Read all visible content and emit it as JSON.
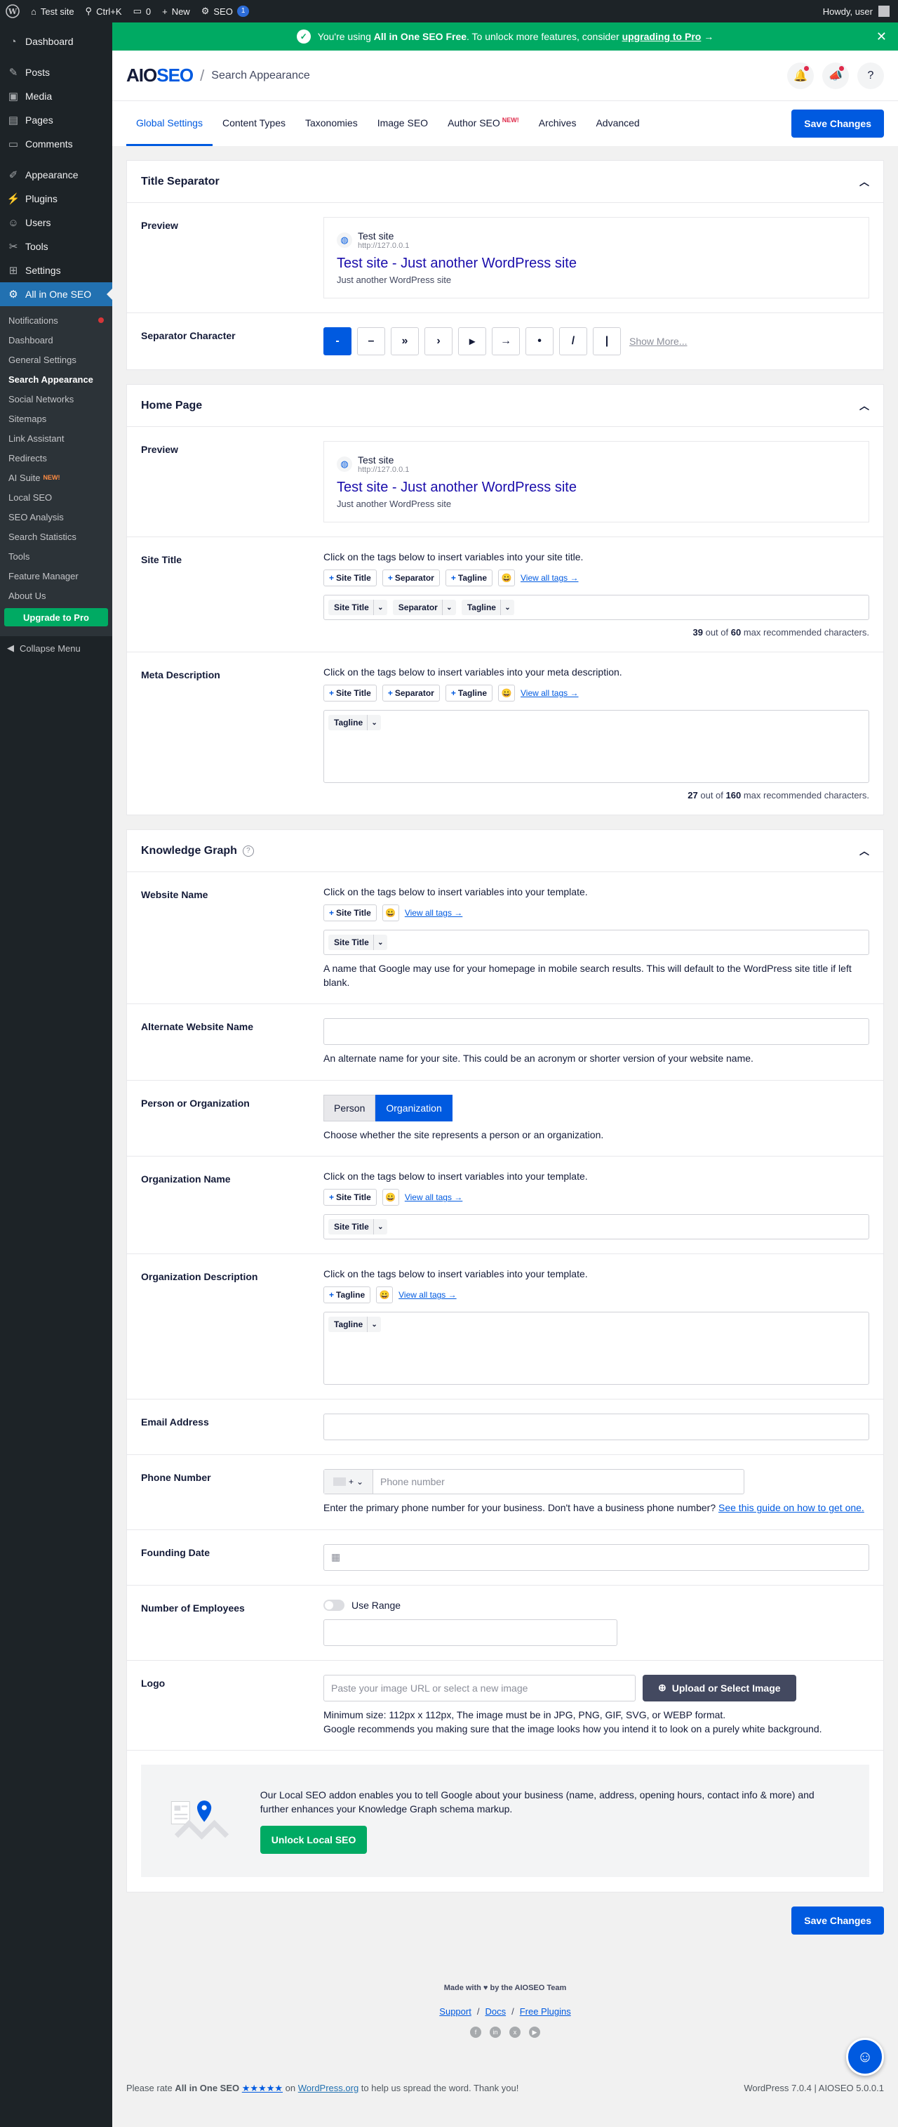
{
  "adminbar": {
    "site": "Test site",
    "search": "Ctrl+K",
    "comments": "0",
    "new": "New",
    "seo": "SEO",
    "seo_count": "1",
    "howdy": "Howdy, user"
  },
  "sidebar": {
    "items": [
      {
        "label": "Dashboard",
        "icon": "dashboard-icon"
      },
      {
        "label": "Posts",
        "icon": "pin-icon"
      },
      {
        "label": "Media",
        "icon": "media-icon"
      },
      {
        "label": "Pages",
        "icon": "pages-icon"
      },
      {
        "label": "Comments",
        "icon": "comment-icon"
      },
      {
        "label": "Appearance",
        "icon": "brush-icon"
      },
      {
        "label": "Plugins",
        "icon": "plugin-icon"
      },
      {
        "label": "Users",
        "icon": "user-icon"
      },
      {
        "label": "Tools",
        "icon": "wrench-icon"
      },
      {
        "label": "Settings",
        "icon": "settings-icon"
      },
      {
        "label": "All in One SEO",
        "icon": "aioseo-icon"
      }
    ],
    "submenu": [
      "Notifications",
      "Dashboard",
      "General Settings",
      "Search Appearance",
      "Social Networks",
      "Sitemaps",
      "Link Assistant",
      "Redirects",
      "AI Suite",
      "Local SEO",
      "SEO Analysis",
      "Search Statistics",
      "Tools",
      "Feature Manager",
      "About Us"
    ],
    "ai_new": "NEW!",
    "upgrade": "Upgrade to Pro",
    "collapse": "Collapse Menu"
  },
  "notice": {
    "text1": "You're using ",
    "bold": "All in One SEO Free",
    "text2": ". To unlock more features, consider ",
    "link": "upgrading to Pro",
    "arrow": "→"
  },
  "header": {
    "logo_a": "AIO",
    "logo_b": "SEO",
    "crumb": "Search Appearance"
  },
  "tabs": [
    {
      "label": "Global Settings",
      "new": ""
    },
    {
      "label": "Content Types",
      "new": ""
    },
    {
      "label": "Taxonomies",
      "new": ""
    },
    {
      "label": "Image SEO",
      "new": ""
    },
    {
      "label": "Author SEO",
      "new": "NEW!"
    },
    {
      "label": "Archives",
      "new": ""
    },
    {
      "label": "Advanced",
      "new": ""
    }
  ],
  "save_label": "Save Changes",
  "title_separator": {
    "heading": "Title Separator",
    "preview_label": "Preview",
    "separator_label": "Separator Character",
    "chars": [
      "-",
      "–",
      "»",
      "›",
      "▸",
      "→",
      "•",
      "/",
      "|"
    ],
    "show_more": "Show More..."
  },
  "preview": {
    "site": "Test site",
    "url": "http://127.0.0.1",
    "title": "Test site - Just another WordPress site",
    "desc": "Just another WordPress site"
  },
  "home_page": {
    "heading": "Home Page",
    "preview_label": "Preview",
    "site_title_label": "Site Title",
    "site_title_hint": "Click on the tags below to insert variables into your site title.",
    "site_title_count": "39",
    "site_title_max": "60",
    "meta_label": "Meta Description",
    "meta_hint": "Click on the tags below to insert variables into your meta description.",
    "meta_count": "27",
    "meta_max": "160",
    "out_of": " out of ",
    "max_text": " max recommended characters."
  },
  "tag_labels": {
    "site_title": "Site Title",
    "separator": "Separator",
    "tagline": "Tagline",
    "view_all": "View all tags →",
    "emoji": "😀"
  },
  "knowledge": {
    "heading": "Knowledge Graph",
    "website_name_label": "Website Name",
    "template_hint": "Click on the tags below to insert variables into your template.",
    "website_name_desc": "A name that Google may use for your homepage in mobile search results. This will default to the WordPress site title if left blank.",
    "alt_name_label": "Alternate Website Name",
    "alt_name_desc": "An alternate name for your site. This could be an acronym or shorter version of your website name.",
    "person_org_label": "Person or Organization",
    "person": "Person",
    "organization": "Organization",
    "person_org_desc": "Choose whether the site represents a person or an organization.",
    "org_name_label": "Organization Name",
    "org_desc_label": "Organization Description",
    "email_label": "Email Address",
    "phone_label": "Phone Number",
    "phone_placeholder": "Phone number",
    "phone_prefix": "+",
    "phone_desc": "Enter the primary phone number for your business. Don't have a business phone number? ",
    "phone_link": "See this guide on how to get one.",
    "founding_label": "Founding Date",
    "employees_label": "Number of Employees",
    "use_range": "Use Range",
    "logo_label": "Logo",
    "logo_placeholder": "Paste your image URL or select a new image",
    "upload_btn": "Upload or Select Image",
    "logo_desc1": "Minimum size: 112px x 112px, The image must be in JPG, PNG, GIF, SVG, or WEBP format.",
    "logo_desc2": "Google recommends you making sure that the image looks how you intend it to look on a purely white background."
  },
  "local_seo": {
    "text": "Our Local SEO addon enables you to tell Google about your business (name, address, opening hours, contact info & more) and further enhances your Knowledge Graph schema markup.",
    "button": "Unlock Local SEO"
  },
  "footer": {
    "made": "Made with ♥ by the AIOSEO Team",
    "support": "Support",
    "docs": "Docs",
    "plugins": "Free Plugins",
    "rate1": "Please rate ",
    "rate_bold": "All in One SEO",
    "stars": "★★★★★",
    "rate2": " on ",
    "wporg": "WordPress.org",
    "rate3": " to help us spread the word. Thank you!",
    "version": "WordPress 7.0.4 | AIOSEO 5.0.0.1"
  }
}
